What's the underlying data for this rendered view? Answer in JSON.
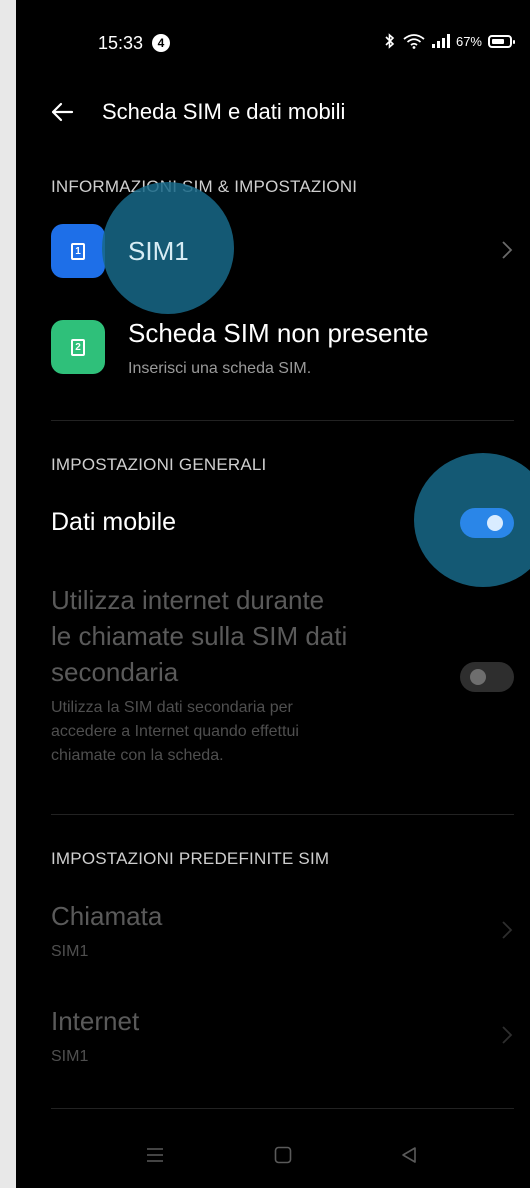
{
  "status_bar": {
    "time": "15:33",
    "notification_count": "4",
    "battery": "67%"
  },
  "header": {
    "title": "Scheda SIM e dati mobili"
  },
  "sim_section": {
    "heading": "INFORMAZIONI SIM & IMPOSTAZIONI",
    "sim1": {
      "label": "SIM1",
      "icon_number": "1",
      "color": "#1e6fe8"
    },
    "sim2": {
      "label": "Scheda SIM non presente",
      "sublabel": "Inserisci una scheda SIM.",
      "icon_number": "2",
      "color": "#2fc07a"
    }
  },
  "general_section": {
    "heading": "IMPOSTAZIONI GENERALI",
    "mobile_data": {
      "label": "Dati mobile",
      "enabled": true
    },
    "secondary_data": {
      "title_lines": [
        "Utilizza internet durante",
        "le chiamate sulla SIM dati",
        "secondaria"
      ],
      "desc_lines": [
        "Utilizza la SIM dati secondaria per",
        "accedere a Internet quando effettui",
        "chiamate con la scheda."
      ],
      "enabled": false
    }
  },
  "default_section": {
    "heading": "IMPOSTAZIONI PREDEFINITE SIM",
    "call": {
      "label": "Chiamata",
      "value": "SIM1"
    },
    "internet": {
      "label": "Internet",
      "value": "SIM1"
    }
  },
  "colors": {
    "accent": "#2a86e8",
    "touch_ripple": "#186888"
  }
}
